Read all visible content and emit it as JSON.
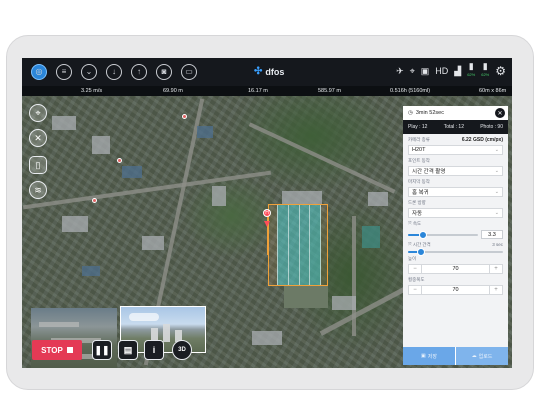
{
  "app": {
    "logo_text": "dfos",
    "logo_icon": "drone-logo-icon"
  },
  "toolbar": {
    "icons": [
      "target-icon",
      "list-icon",
      "landing-icon",
      "download-icon",
      "upload-icon",
      "camera-settings-icon",
      "map-view-icon"
    ],
    "status": [
      {
        "icon": "drone-icon",
        "label": ""
      },
      {
        "icon": "satellite-icon",
        "label": ""
      },
      {
        "icon": "controller-icon",
        "label": ""
      },
      {
        "icon": "hd-icon",
        "value": "HD",
        "label": ""
      },
      {
        "icon": "signal-icon",
        "label": ""
      },
      {
        "icon": "battery-icon",
        "label": "62%"
      },
      {
        "icon": "battery-icon",
        "label": "62%"
      }
    ],
    "settings_icon": "gear-icon"
  },
  "telemetry": [
    {
      "label": "",
      "value": "3.25 m/s"
    },
    {
      "label": "",
      "value": "69.90 m"
    },
    {
      "label": "",
      "value": "16.17 m"
    },
    {
      "label": "",
      "value": "585.97 m"
    },
    {
      "label": "",
      "value": "0.516h (5160ml)"
    },
    {
      "label": "",
      "value": "60m x 86m"
    }
  ],
  "panel": {
    "time": "3min 52sec",
    "stats": {
      "play": "Play : 12",
      "total": "Total : 12",
      "photo": "Photo : 90"
    },
    "camera_label": "카메라 종류",
    "gsd": "6.22 GSD (cm/px)",
    "camera_value": "H20T",
    "point_action_label": "포인트 동작",
    "point_action_value": "시간 간격 촬영",
    "finish_action_label": "마지막 동작",
    "finish_action_value": "홈 복귀",
    "drone_heading_label": "드론 방향",
    "drone_heading_value": "자동",
    "speed_label": "속도",
    "speed_value": "3.3",
    "speed_fraction": 0.22,
    "interval_label": "시간 간격",
    "interval_unit": "3 sec",
    "interval_fraction": 0.14,
    "altitude_label": "높이",
    "altitude_value": "70",
    "overlap_label": "횡중복도",
    "overlap_value": "70",
    "save_label": "저장",
    "upload_label": "업로드"
  },
  "map_labels": [],
  "controls": {
    "stop_label": "STOP",
    "pause_icon": "pause-icon",
    "document_icon": "document-icon",
    "info_icon": "info-icon",
    "view_3d": "3D"
  }
}
